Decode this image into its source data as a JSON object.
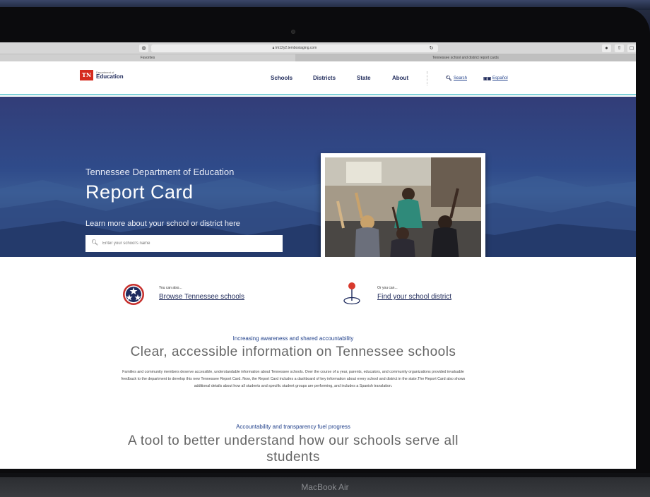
{
  "browser": {
    "url": "trk12y2.tembostaging.com",
    "favorites_label": "Favorites",
    "tab_title": "Tennessee school and district report cards"
  },
  "header": {
    "logo": {
      "badge": "TN",
      "dept": "Department of",
      "name": "Education"
    },
    "nav": [
      "Schools",
      "Districts",
      "State",
      "About"
    ],
    "search_label": "Search",
    "language_label": "Español"
  },
  "hero": {
    "subtitle": "Tennessee Department of Education",
    "title": "Report Card",
    "learn": "Learn more about your school or district here",
    "search_placeholder": "Enter your school's name"
  },
  "alternatives": [
    {
      "prefix": "You can also...",
      "link": "Browse Tennessee schools",
      "icon": "tennessee-tri-star-icon"
    },
    {
      "prefix": "Or you can...",
      "link": "Find your school district",
      "icon": "map-pin-icon"
    }
  ],
  "section1": {
    "kicker": "Increasing awareness and shared accountability",
    "headline": "Clear, accessible information on Tennessee schools",
    "body": "Families and community members deserve accessible, understandable information about Tennessee schools. Over the course of a year, parents, educators, and community organizations provided invaluable feedback to the department to develop this new Tennessee Report Card. Now, the Report Card includes a dashboard of key information about every school and district in the state.The Report Card also shows additional details about how all students and specific student groups are performing, and includes a Spanish translation."
  },
  "section2": {
    "kicker": "Accountability and transparency fuel progress",
    "headline": "A tool to better understand how our schools serve all students"
  },
  "device": {
    "label": "MacBook Air"
  },
  "colors": {
    "navy": "#1f2a5a",
    "tn_red": "#d52b1e",
    "accent_teal": "#7ed0d8",
    "hero_blue": "#2f4b8a"
  }
}
